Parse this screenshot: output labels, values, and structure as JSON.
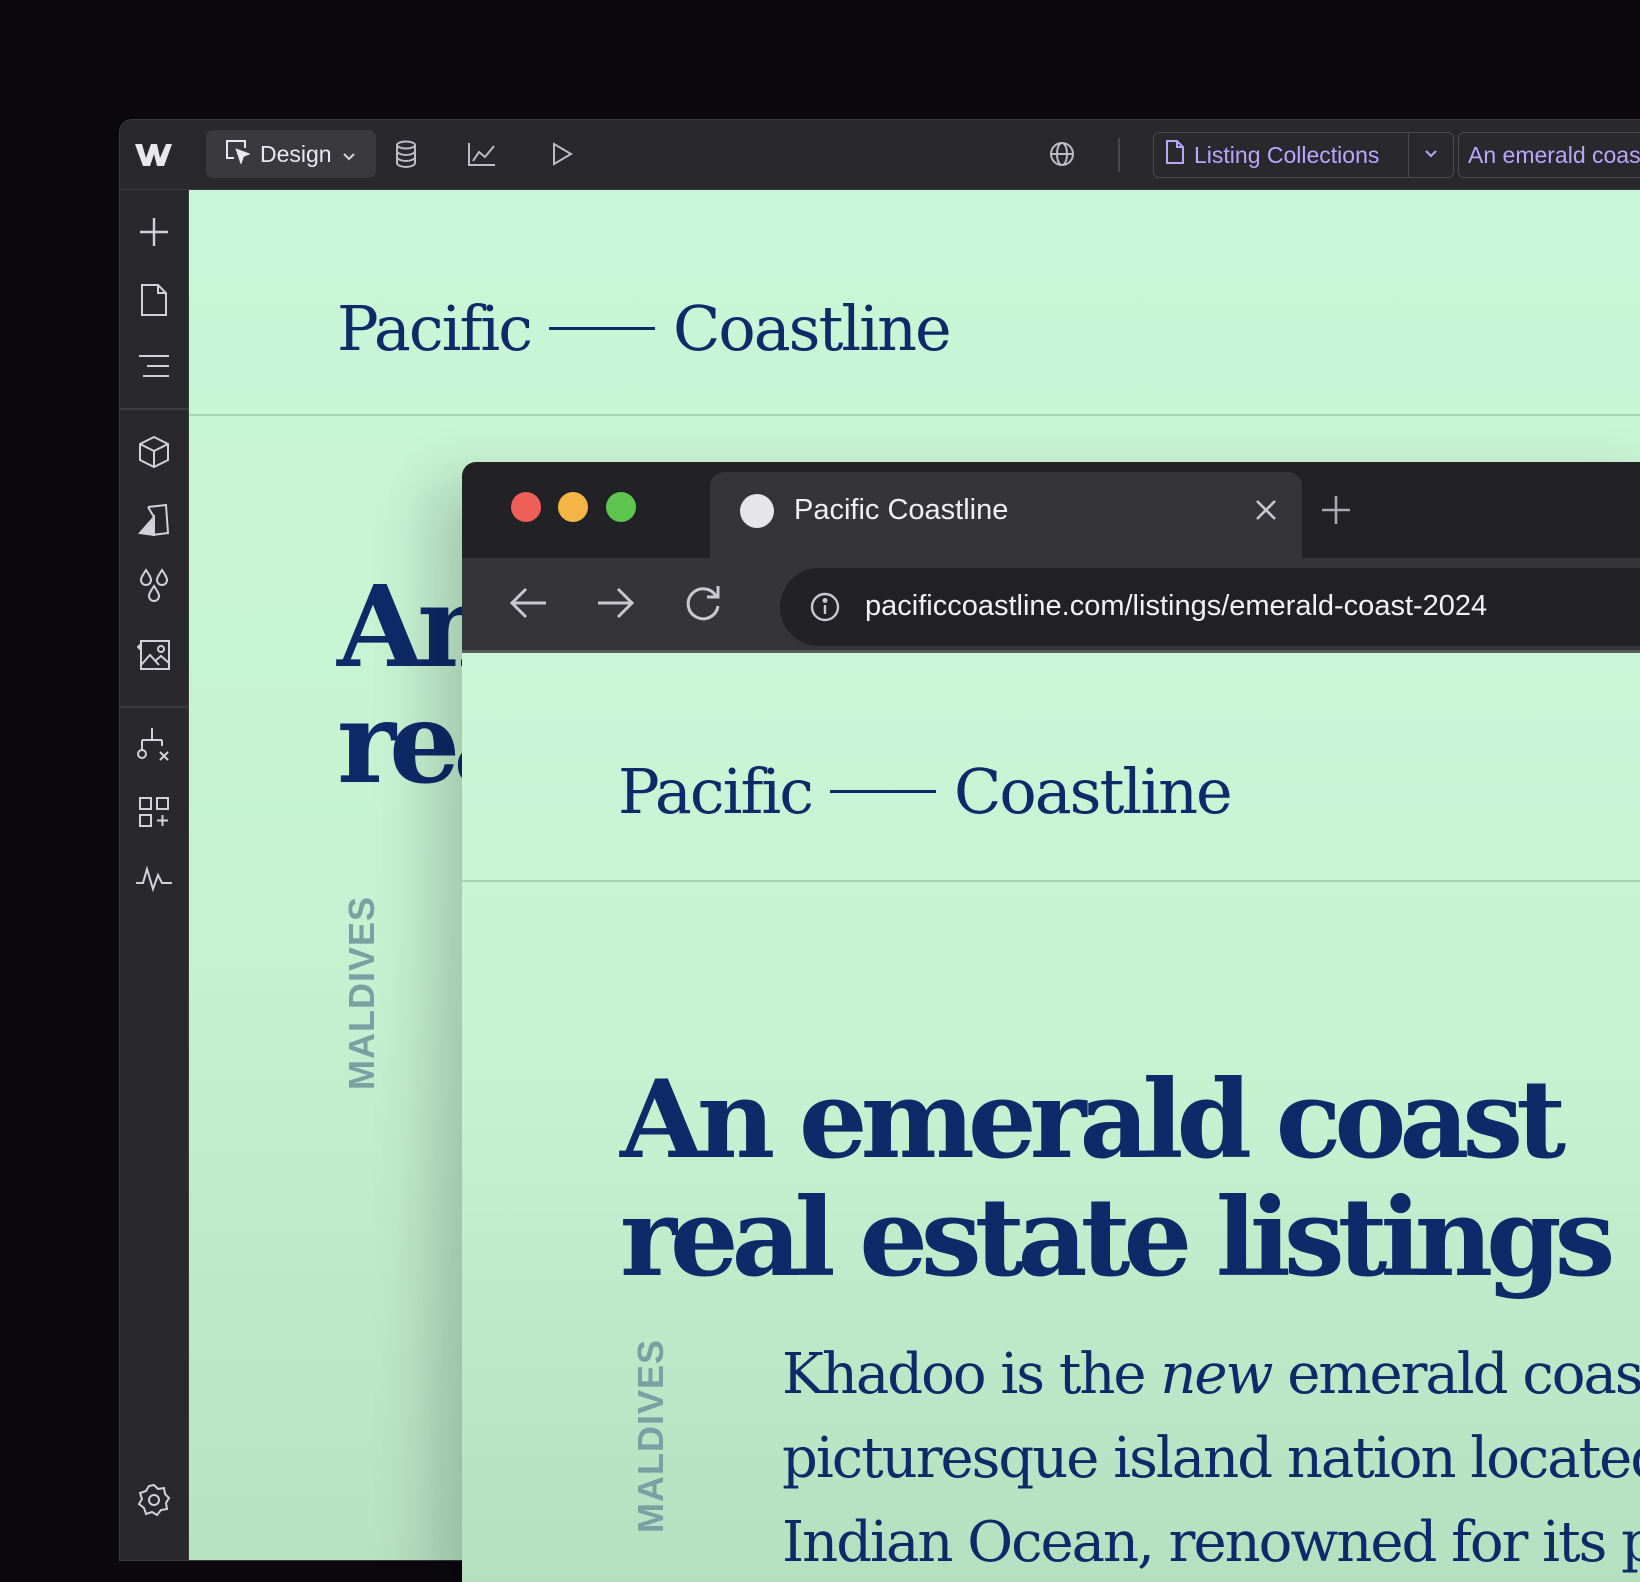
{
  "designer": {
    "mode_label": "Design",
    "page_selector": "Listing Collections",
    "item_selector": "An emerald coast"
  },
  "canvas": {
    "brand_left": "Pacific",
    "brand_right": "Coastline",
    "heading_partial_line1": "An",
    "heading_partial_line2": "rea",
    "vertical_label": "MALDIVES"
  },
  "browser": {
    "tab_title": "Pacific Coastline",
    "url": "pacificcoastline.com/listings/emerald-coast-2024",
    "page": {
      "brand_left": "Pacific",
      "brand_right": "Coastline",
      "heading_line1": "An emerald coast",
      "heading_line2": "real estate listings",
      "vertical_label": "MALDIVES",
      "body_line1_a": "Khadoo is the ",
      "body_line1_em": "new",
      "body_line1_b": " emerald coast is a",
      "body_line2": "picturesque island nation located in the",
      "body_line3": "Indian Ocean, renowned for its pristine"
    }
  },
  "colors": {
    "canvas_bg": "#c9f6d6",
    "brand_navy": "#0f2a69",
    "accent_purple": "#b9a7ff",
    "traffic_red": "#ee5f57",
    "traffic_yellow": "#f4b545",
    "traffic_green": "#5dc54d"
  }
}
